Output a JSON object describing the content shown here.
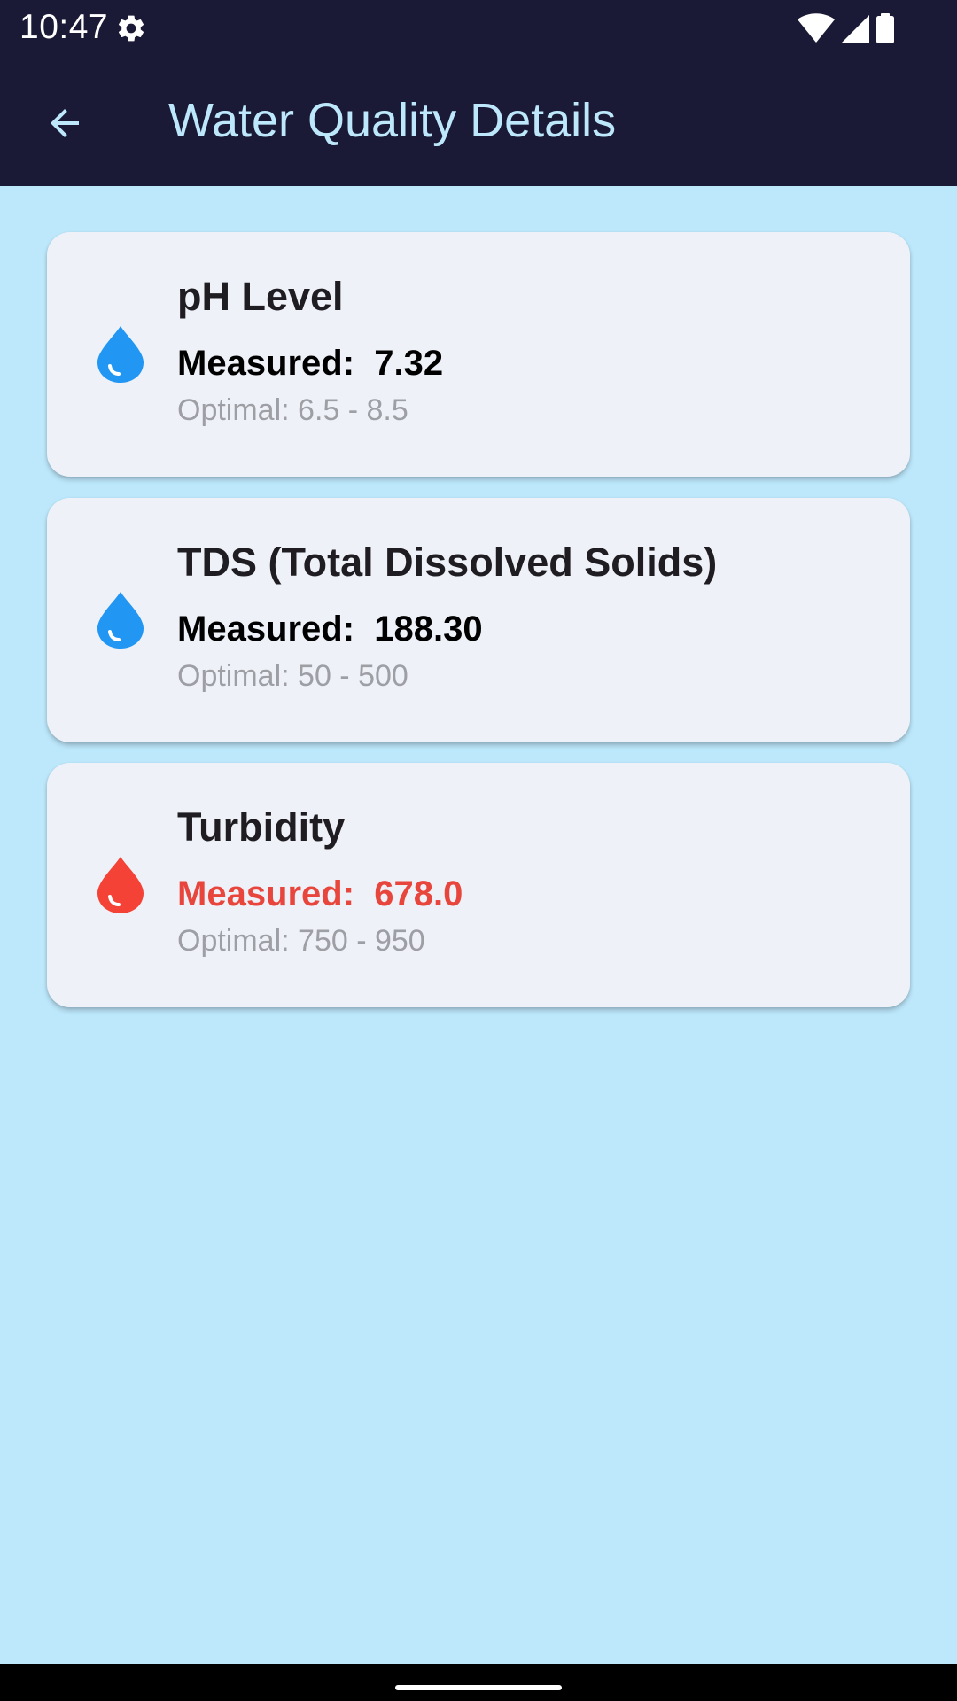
{
  "status_bar": {
    "time": "10:47",
    "icons": [
      "settings-icon",
      "wifi-icon",
      "signal-icon",
      "battery-icon"
    ]
  },
  "app_bar": {
    "back_icon": "arrow-back-icon",
    "title": "Water Quality Details",
    "background_color": "#1B1A36",
    "title_color": "#BDE8FC"
  },
  "colors": {
    "page_background": "#BDE8FC",
    "card_background": "#EEF2F8",
    "ok_color": "#2196F3",
    "alert_color": "#E8463D"
  },
  "parameters": [
    {
      "title": "pH Level",
      "measured": "Measured:  7.32",
      "optimal": "Optimal: 6.5 - 8.5",
      "status": "ok",
      "icon": "water-drop-icon",
      "icon_color": "#2196F3"
    },
    {
      "title": "TDS (Total Dissolved Solids)",
      "measured": "Measured:  188.30",
      "optimal": "Optimal: 50 - 500",
      "status": "ok",
      "icon": "water-drop-icon",
      "icon_color": "#2196F3"
    },
    {
      "title": "Turbidity",
      "measured": "Measured:  678.0",
      "optimal": "Optimal: 750 - 950",
      "status": "alert",
      "icon": "water-drop-icon",
      "icon_color": "#F44336"
    }
  ]
}
